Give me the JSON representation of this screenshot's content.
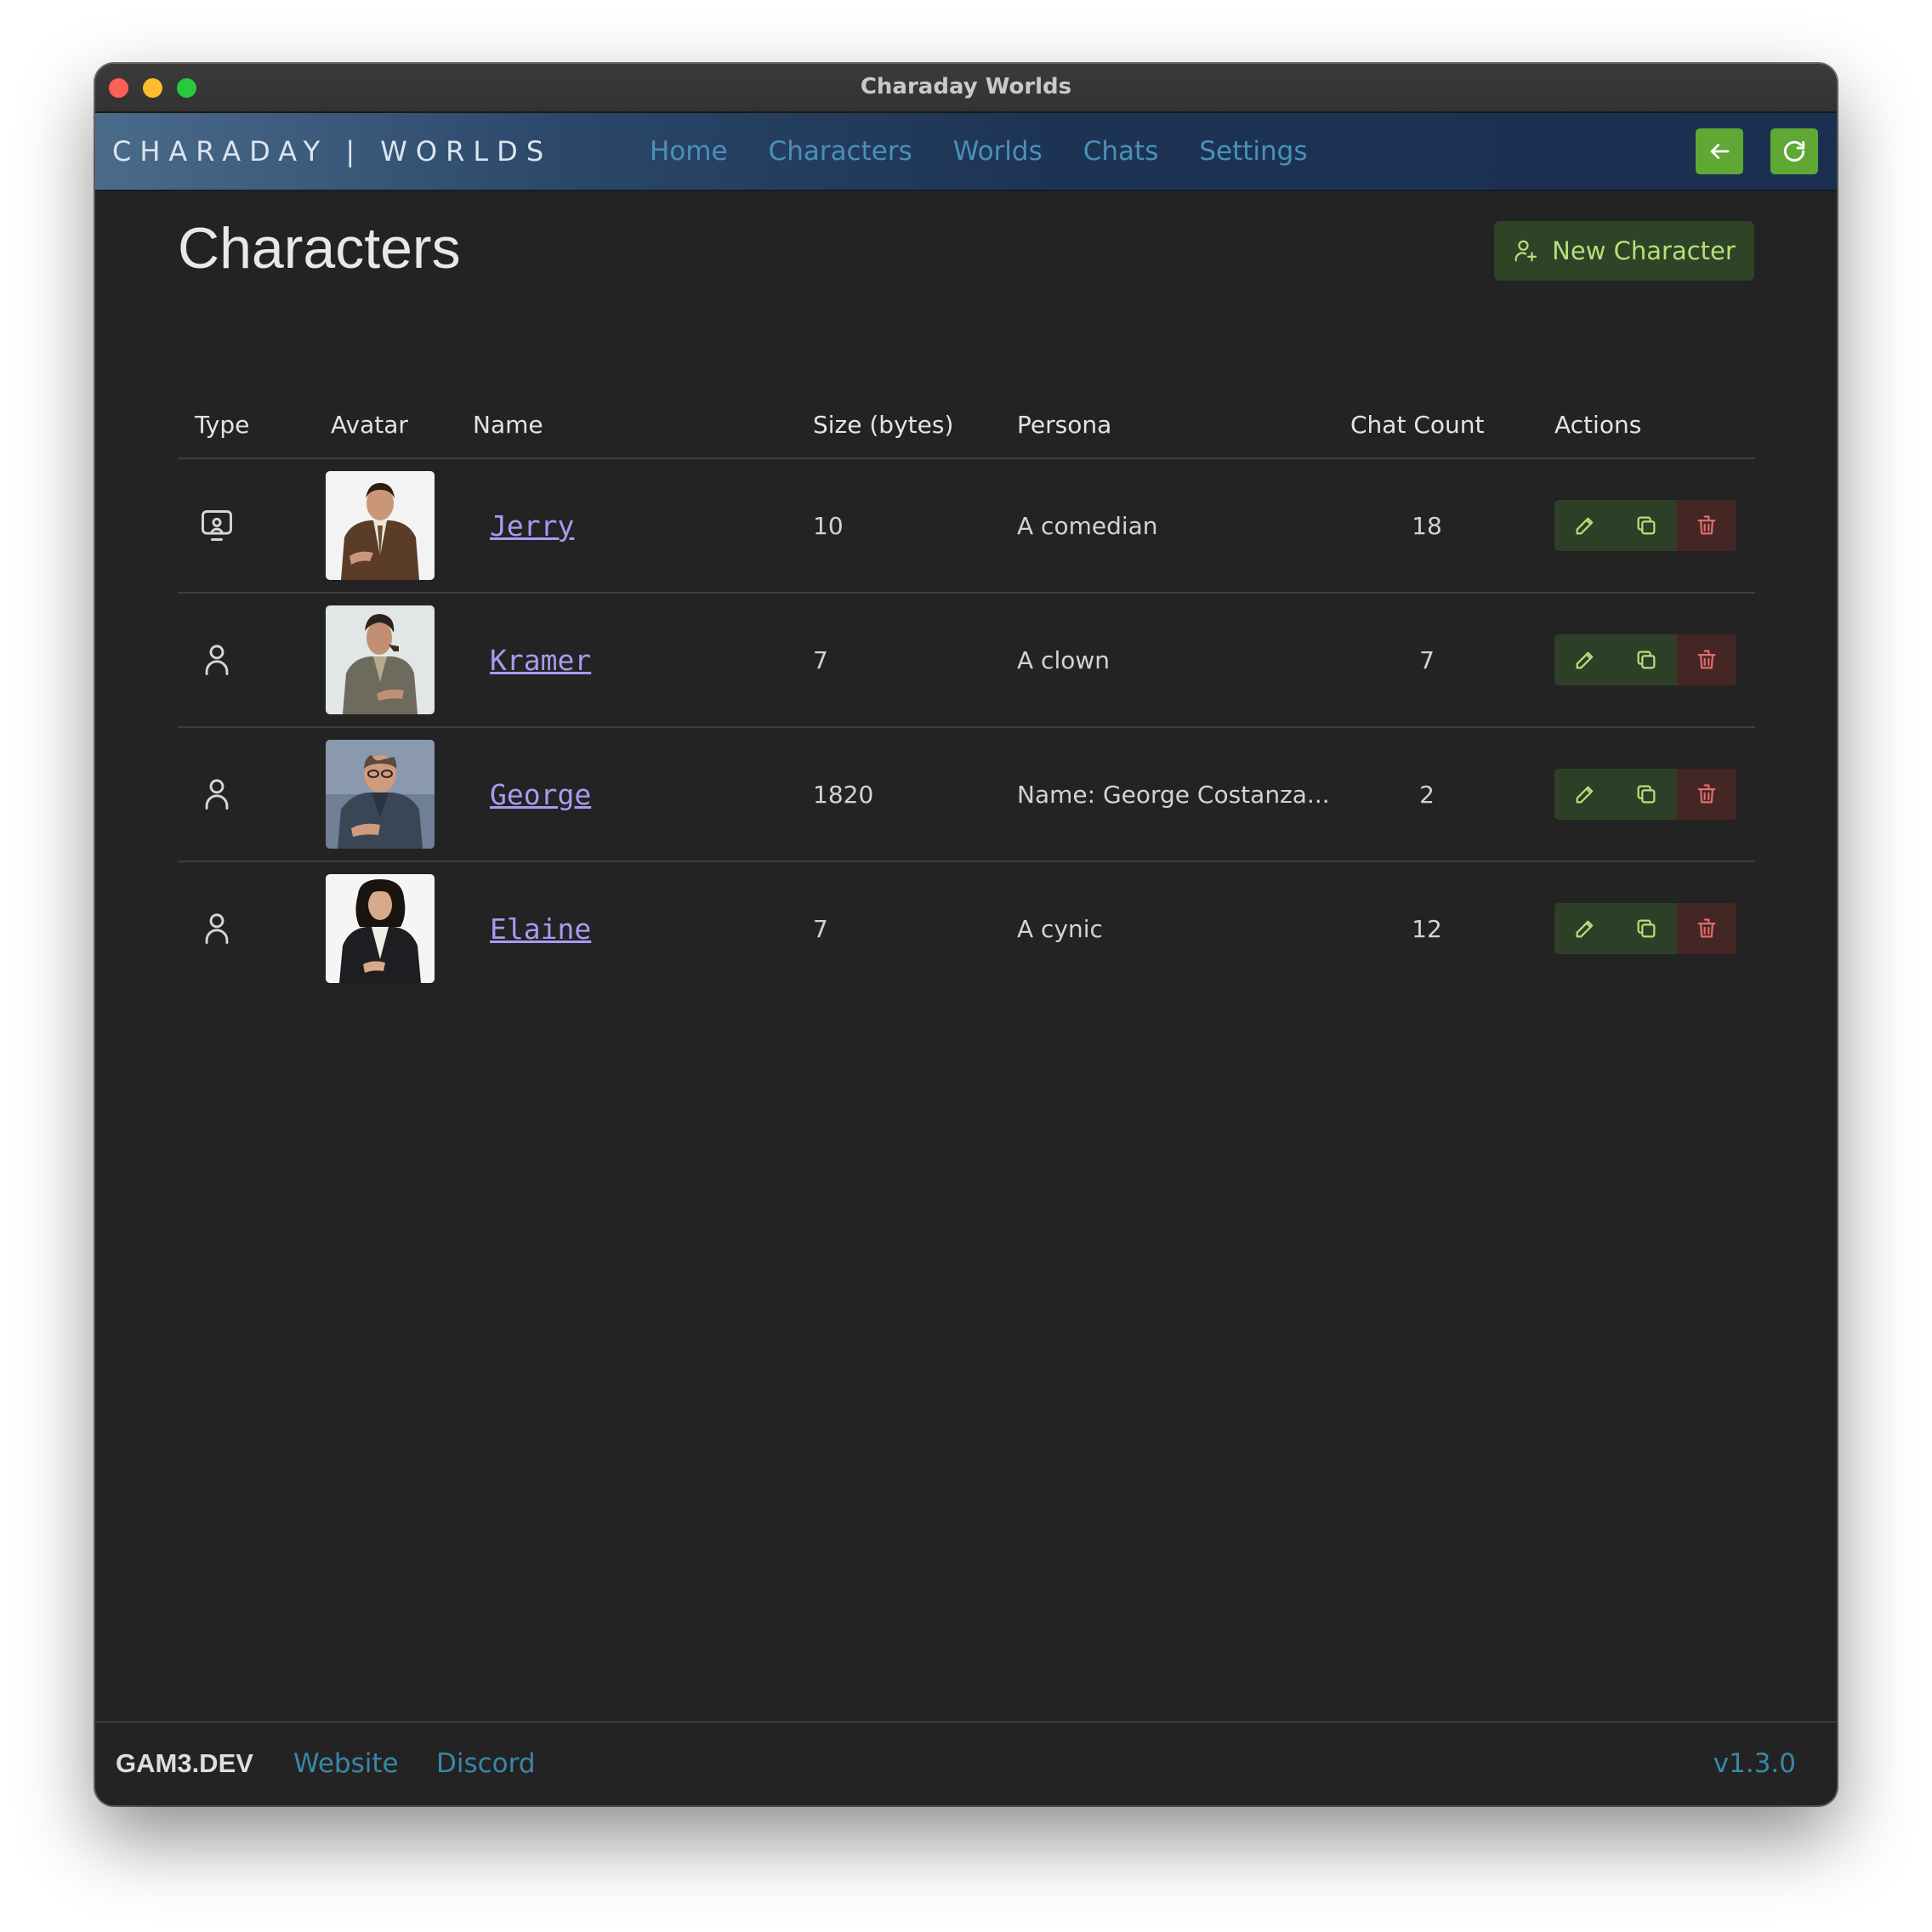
{
  "window": {
    "title": "Charaday Worlds"
  },
  "navbar": {
    "brand": "CHARADAY | WORLDS",
    "links": [
      "Home",
      "Characters",
      "Worlds",
      "Chats",
      "Settings"
    ],
    "back_icon": "arrow-left-icon",
    "refresh_icon": "refresh-icon"
  },
  "page": {
    "title": "Characters",
    "new_button_label": "New Character",
    "new_button_icon": "user-plus-icon"
  },
  "table": {
    "headers": [
      "Type",
      "Avatar",
      "Name",
      "Size (bytes)",
      "Persona",
      "Chat Count",
      "Actions"
    ],
    "rows": [
      {
        "type_icon": "screen-user-icon",
        "name": "Jerry",
        "size": "10",
        "persona": "A comedian",
        "chat_count": "18",
        "avatar_color": "#5a3c28"
      },
      {
        "type_icon": "user-icon",
        "name": "Kramer",
        "size": "7",
        "persona": "A clown",
        "chat_count": "7",
        "avatar_color": "#6d6a5e"
      },
      {
        "type_icon": "user-icon",
        "name": "George",
        "size": "1820",
        "persona": "Name: George Costanza...",
        "chat_count": "2",
        "avatar_color": "#4a5870"
      },
      {
        "type_icon": "user-icon",
        "name": "Elaine",
        "size": "7",
        "persona": "A cynic",
        "chat_count": "12",
        "avatar_color": "#1e1e22"
      }
    ],
    "action_icons": [
      "pencil-icon",
      "copy-icon",
      "trash-icon"
    ]
  },
  "footer": {
    "brand": "GAM3.DEV",
    "links": [
      "Website",
      "Discord"
    ],
    "version": "v1.3.0"
  },
  "colors": {
    "accent_green": "#5fa833",
    "link_blue": "#4a90b8",
    "name_link": "#a59cf2",
    "delete_red": "#e06c6c"
  }
}
